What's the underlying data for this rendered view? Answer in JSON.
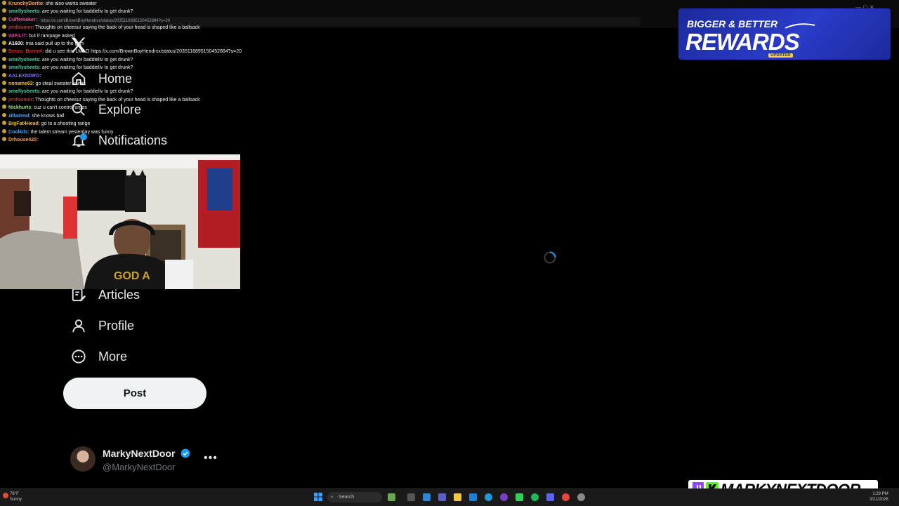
{
  "browser": {
    "url": "https://x.com/BrownBoyHendrxx/status/2035116895150452884?s=20",
    "window_controls": "—  ▢  ✕"
  },
  "sidebar": {
    "items": [
      {
        "label": "Home",
        "icon": "home-icon"
      },
      {
        "label": "Explore",
        "icon": "search-icon"
      },
      {
        "label": "Notifications",
        "icon": "bell-icon"
      },
      {
        "label": "Articles",
        "icon": "articles-icon"
      },
      {
        "label": "Profile",
        "icon": "person-icon"
      },
      {
        "label": "More",
        "icon": "more-circle-icon"
      }
    ],
    "post_label": "Post"
  },
  "account": {
    "display_name": "MarkyNextDoor",
    "handle": "@MarkyNextDoor",
    "more": "•••"
  },
  "chat": [
    {
      "user": "KrunchyDorito",
      "color": "#ff9f45",
      "msg": "she also wants sweater"
    },
    {
      "user": "smellysheets",
      "color": "#4fd1a5",
      "msg": "are you waiting for baddieliv to get drunk?"
    },
    {
      "user": "Cuffemaker",
      "color": "#e05a9b",
      "msg": ""
    },
    {
      "user": "jerdoumer",
      "color": "#b13a3a",
      "msg": "Thoughts on cheesur saying the back of your head is shaped like a ballsack"
    },
    {
      "user": "WIFiLIT",
      "color": "#c2409c",
      "msg": "but if rampage asked"
    },
    {
      "user": "A1600",
      "color": "#ffffff",
      "msg": "mia said pull up to the gym"
    },
    {
      "user": "Deezo_Bonnel",
      "color": "#d9262c",
      "msg": "did u see this LMAO https://x.com/BrownBoyHendrxx/status/2035116895150452884?s=20"
    },
    {
      "user": "smellysheets",
      "color": "#4fd1a5",
      "msg": "are you waiting for baddieliv to get drunk?"
    },
    {
      "user": "smellysheets",
      "color": "#4fd1a5",
      "msg": "are you waiting for baddieliv to get drunk?"
    },
    {
      "user": "AALEXNDRO",
      "color": "#7b6cf6",
      "msg": ""
    },
    {
      "user": "noname63",
      "color": "#f0c419",
      "msg": "go steal sweater xanax"
    },
    {
      "user": "smellysheets",
      "color": "#4fd1a5",
      "msg": "are you waiting for baddieliv to get drunk?"
    },
    {
      "user": "jerdoumer",
      "color": "#b13a3a",
      "msg": "Thoughts on cheesur saying the back of your head is shaped like a ballsack"
    },
    {
      "user": "Nickhurts",
      "color": "#9be07a",
      "msg": "cuz u can't control urges"
    },
    {
      "user": "zilla4real",
      "color": "#3fa7ff",
      "msg": "she knows ball"
    },
    {
      "user": "BigFat4Head",
      "color": "#f0c419",
      "msg": "go to a shooting range"
    },
    {
      "user": "Coolkds",
      "color": "#3fa7ff",
      "msg": "the talent stream yesterday was funny"
    },
    {
      "user": "Drhouse420",
      "color": "#ff9f45",
      "msg": ""
    }
  ],
  "rewards_banner": {
    "top": "BIGGER & BETTER",
    "big": "REWARDS",
    "tag": "UPDATED"
  },
  "brand": {
    "name": "MARKYNEXTDOOR"
  },
  "taskbar": {
    "weather_temp": "78°F",
    "weather_cond": "Sunny",
    "search": "Search",
    "time": "1:29 PM",
    "date": "3/21/2026"
  },
  "colors": {
    "x_blue": "#1d9bf0",
    "post_bg": "#eff3f4",
    "handle_gray": "#71767b",
    "rewards_blue": "#2a3cc9",
    "twitch_purple": "#9146ff",
    "kick_green": "#53fc18"
  }
}
